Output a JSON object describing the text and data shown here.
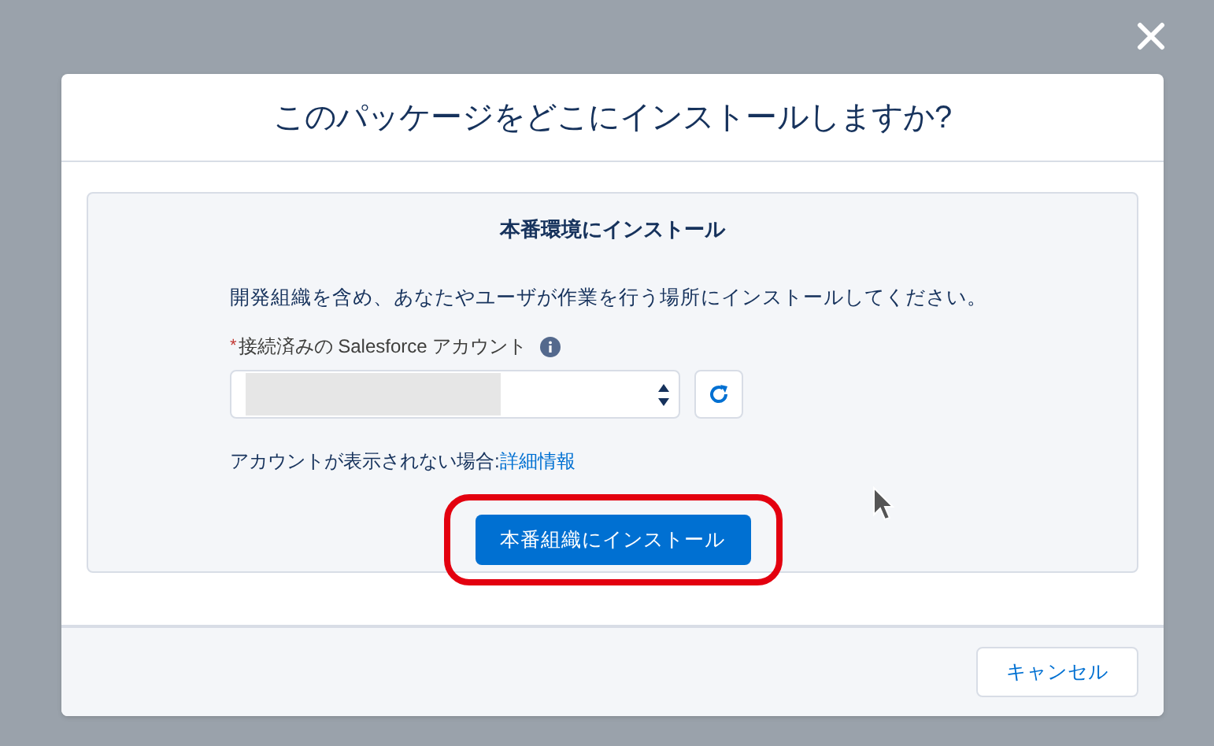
{
  "modal": {
    "title": "このパッケージをどこにインストールしますか?",
    "section": {
      "title": "本番環境にインストール",
      "description": "開発組織を含め、あなたやユーザが作業を行う場所にインストールしてください。",
      "field": {
        "label": "接続済みの Salesforce アカウント",
        "required_mark": "*"
      },
      "help_text": "アカウントが表示されない場合:",
      "help_link": "詳細情報",
      "install_button": {
        "label": "本番組織にインストール",
        "highlighted": true
      }
    },
    "footer": {
      "cancel_button": "キャンセル"
    }
  }
}
